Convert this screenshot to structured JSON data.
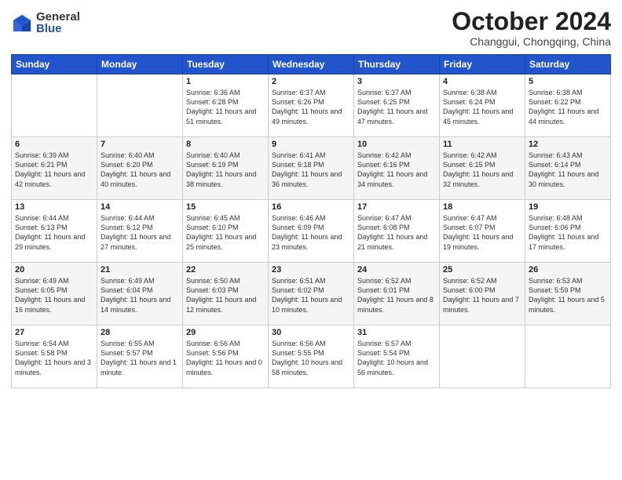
{
  "header": {
    "logo_general": "General",
    "logo_blue": "Blue",
    "month_title": "October 2024",
    "location": "Changgui, Chongqing, China"
  },
  "weekdays": [
    "Sunday",
    "Monday",
    "Tuesday",
    "Wednesday",
    "Thursday",
    "Friday",
    "Saturday"
  ],
  "weeks": [
    [
      {
        "day": "",
        "info": ""
      },
      {
        "day": "",
        "info": ""
      },
      {
        "day": "1",
        "info": "Sunrise: 6:36 AM\nSunset: 6:28 PM\nDaylight: 11 hours and 51 minutes."
      },
      {
        "day": "2",
        "info": "Sunrise: 6:37 AM\nSunset: 6:26 PM\nDaylight: 11 hours and 49 minutes."
      },
      {
        "day": "3",
        "info": "Sunrise: 6:37 AM\nSunset: 6:25 PM\nDaylight: 11 hours and 47 minutes."
      },
      {
        "day": "4",
        "info": "Sunrise: 6:38 AM\nSunset: 6:24 PM\nDaylight: 11 hours and 45 minutes."
      },
      {
        "day": "5",
        "info": "Sunrise: 6:38 AM\nSunset: 6:22 PM\nDaylight: 11 hours and 44 minutes."
      }
    ],
    [
      {
        "day": "6",
        "info": "Sunrise: 6:39 AM\nSunset: 6:21 PM\nDaylight: 11 hours and 42 minutes."
      },
      {
        "day": "7",
        "info": "Sunrise: 6:40 AM\nSunset: 6:20 PM\nDaylight: 11 hours and 40 minutes."
      },
      {
        "day": "8",
        "info": "Sunrise: 6:40 AM\nSunset: 6:19 PM\nDaylight: 11 hours and 38 minutes."
      },
      {
        "day": "9",
        "info": "Sunrise: 6:41 AM\nSunset: 6:18 PM\nDaylight: 11 hours and 36 minutes."
      },
      {
        "day": "10",
        "info": "Sunrise: 6:42 AM\nSunset: 6:16 PM\nDaylight: 11 hours and 34 minutes."
      },
      {
        "day": "11",
        "info": "Sunrise: 6:42 AM\nSunset: 6:15 PM\nDaylight: 11 hours and 32 minutes."
      },
      {
        "day": "12",
        "info": "Sunrise: 6:43 AM\nSunset: 6:14 PM\nDaylight: 11 hours and 30 minutes."
      }
    ],
    [
      {
        "day": "13",
        "info": "Sunrise: 6:44 AM\nSunset: 6:13 PM\nDaylight: 11 hours and 29 minutes."
      },
      {
        "day": "14",
        "info": "Sunrise: 6:44 AM\nSunset: 6:12 PM\nDaylight: 11 hours and 27 minutes."
      },
      {
        "day": "15",
        "info": "Sunrise: 6:45 AM\nSunset: 6:10 PM\nDaylight: 11 hours and 25 minutes."
      },
      {
        "day": "16",
        "info": "Sunrise: 6:46 AM\nSunset: 6:09 PM\nDaylight: 11 hours and 23 minutes."
      },
      {
        "day": "17",
        "info": "Sunrise: 6:47 AM\nSunset: 6:08 PM\nDaylight: 11 hours and 21 minutes."
      },
      {
        "day": "18",
        "info": "Sunrise: 6:47 AM\nSunset: 6:07 PM\nDaylight: 11 hours and 19 minutes."
      },
      {
        "day": "19",
        "info": "Sunrise: 6:48 AM\nSunset: 6:06 PM\nDaylight: 11 hours and 17 minutes."
      }
    ],
    [
      {
        "day": "20",
        "info": "Sunrise: 6:49 AM\nSunset: 6:05 PM\nDaylight: 11 hours and 16 minutes."
      },
      {
        "day": "21",
        "info": "Sunrise: 6:49 AM\nSunset: 6:04 PM\nDaylight: 11 hours and 14 minutes."
      },
      {
        "day": "22",
        "info": "Sunrise: 6:50 AM\nSunset: 6:03 PM\nDaylight: 11 hours and 12 minutes."
      },
      {
        "day": "23",
        "info": "Sunrise: 6:51 AM\nSunset: 6:02 PM\nDaylight: 11 hours and 10 minutes."
      },
      {
        "day": "24",
        "info": "Sunrise: 6:52 AM\nSunset: 6:01 PM\nDaylight: 11 hours and 8 minutes."
      },
      {
        "day": "25",
        "info": "Sunrise: 6:52 AM\nSunset: 6:00 PM\nDaylight: 11 hours and 7 minutes."
      },
      {
        "day": "26",
        "info": "Sunrise: 6:53 AM\nSunset: 5:59 PM\nDaylight: 11 hours and 5 minutes."
      }
    ],
    [
      {
        "day": "27",
        "info": "Sunrise: 6:54 AM\nSunset: 5:58 PM\nDaylight: 11 hours and 3 minutes."
      },
      {
        "day": "28",
        "info": "Sunrise: 6:55 AM\nSunset: 5:57 PM\nDaylight: 11 hours and 1 minute."
      },
      {
        "day": "29",
        "info": "Sunrise: 6:56 AM\nSunset: 5:56 PM\nDaylight: 11 hours and 0 minutes."
      },
      {
        "day": "30",
        "info": "Sunrise: 6:56 AM\nSunset: 5:55 PM\nDaylight: 10 hours and 58 minutes."
      },
      {
        "day": "31",
        "info": "Sunrise: 6:57 AM\nSunset: 5:54 PM\nDaylight: 10 hours and 56 minutes."
      },
      {
        "day": "",
        "info": ""
      },
      {
        "day": "",
        "info": ""
      }
    ]
  ]
}
